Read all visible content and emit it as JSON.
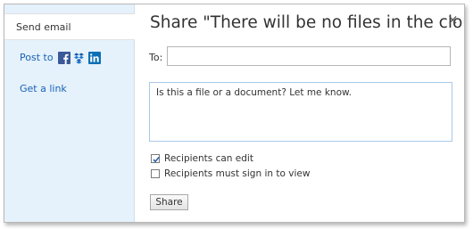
{
  "dialog": {
    "title": "Share \"There will be no files in the cloud\"",
    "close_symbol": "×"
  },
  "sidebar": {
    "items": [
      {
        "label": "Send email",
        "active": true
      },
      {
        "label": "Post to",
        "icons": [
          "facebook-icon",
          "windows-live-icon",
          "linkedin-icon"
        ]
      },
      {
        "label": "Get a link"
      }
    ]
  },
  "form": {
    "to_label": "To:",
    "to_value": "",
    "message": "Is this a file or a document? Let me know.",
    "checkboxes": [
      {
        "label": "Recipients can edit",
        "checked": true
      },
      {
        "label": "Recipients must sign in to view",
        "checked": false
      }
    ],
    "share_label": "Share"
  },
  "colors": {
    "sidebar_bg": "#e5f1fb",
    "link": "#1a63b5",
    "facebook": "#3b5998",
    "linkedin": "#0a6fb5"
  }
}
